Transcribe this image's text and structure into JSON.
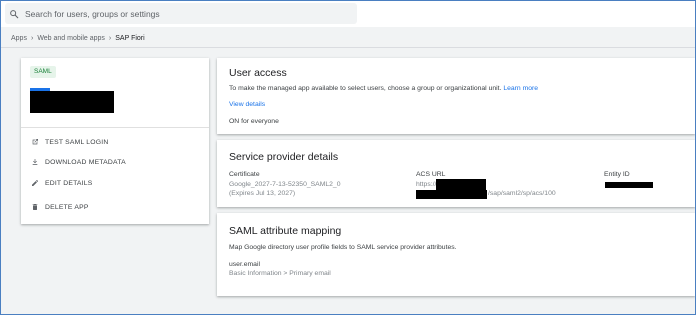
{
  "search": {
    "placeholder": "Search for users, groups or settings"
  },
  "breadcrumb": {
    "items": [
      "Apps",
      "Web and mobile apps",
      "SAP Fiori"
    ]
  },
  "app_card": {
    "badge": "SAML",
    "actions": [
      {
        "label": "TEST SAML LOGIN",
        "icon": "open-in-new-icon"
      },
      {
        "label": "DOWNLOAD METADATA",
        "icon": "download-icon"
      },
      {
        "label": "EDIT DETAILS",
        "icon": "pencil-icon"
      },
      {
        "label": "DELETE APP",
        "icon": "trash-icon"
      }
    ]
  },
  "user_access": {
    "title": "User access",
    "description": "To make the managed app available to select users, choose a group or organizational unit.",
    "learn_more": "Learn more",
    "view_details": "View details",
    "status": "ON for everyone"
  },
  "service_provider": {
    "title": "Service provider details",
    "certificate_label": "Certificate",
    "certificate_name": "Google_2027-7-13-52350_SAML2_0",
    "certificate_expiry": "(Expires Jul 13, 2027)",
    "acs_label": "ACS URL",
    "acs_prefix": "https://",
    "acs_suffix": "/sap/saml2/sp/acs/100",
    "entity_label": "Entity ID"
  },
  "attribute_mapping": {
    "title": "SAML attribute mapping",
    "description": "Map Google directory user profile fields to SAML service provider attributes.",
    "attribute": "user.email",
    "source": "Basic Information > Primary email"
  },
  "colors": {
    "accent": "#1a73e8",
    "badge_bg": "#e6f4ea",
    "badge_text": "#188038",
    "frame_border": "#4a7fc1"
  }
}
